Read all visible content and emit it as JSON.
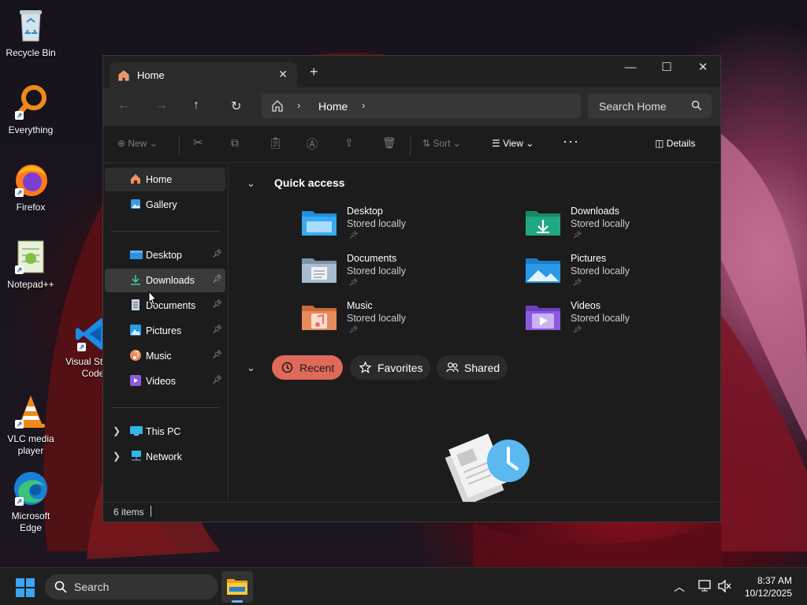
{
  "desktop": {
    "icons": [
      {
        "label": "Recycle Bin"
      },
      {
        "label": "Everything"
      },
      {
        "label": "Firefox"
      },
      {
        "label": "Notepad++"
      },
      {
        "label": "Visual Studio Code"
      },
      {
        "label": "VLC media player"
      },
      {
        "label": "Microsoft Edge"
      }
    ]
  },
  "window": {
    "tab_title": "Home",
    "path": "Home",
    "search_placeholder": "Search Home",
    "toolbar": {
      "new_label": "New",
      "sort_label": "Sort",
      "view_label": "View",
      "details_label": "Details"
    },
    "sidebar": {
      "top": [
        {
          "label": "Home"
        },
        {
          "label": "Gallery"
        }
      ],
      "pinned": [
        {
          "label": "Desktop"
        },
        {
          "label": "Downloads"
        },
        {
          "label": "Documents"
        },
        {
          "label": "Pictures"
        },
        {
          "label": "Music"
        },
        {
          "label": "Videos"
        }
      ],
      "bottom": [
        {
          "label": "This PC"
        },
        {
          "label": "Network"
        }
      ]
    },
    "quick_access": {
      "heading": "Quick access",
      "items": [
        {
          "name": "Desktop",
          "status": "Stored locally",
          "color": "#1e90e0"
        },
        {
          "name": "Downloads",
          "status": "Stored locally",
          "color": "#1fa882"
        },
        {
          "name": "Documents",
          "status": "Stored locally",
          "color": "#9fb3c8"
        },
        {
          "name": "Pictures",
          "status": "Stored locally",
          "color": "#2a9ae8"
        },
        {
          "name": "Music",
          "status": "Stored locally",
          "color": "#e88b5a"
        },
        {
          "name": "Videos",
          "status": "Stored locally",
          "color": "#8a5ae0"
        }
      ]
    },
    "filters": {
      "recent": "Recent",
      "favorites": "Favorites",
      "shared": "Shared"
    },
    "status_text": "6 items"
  },
  "taskbar": {
    "search_placeholder": "Search",
    "time": "8:37 AM",
    "date": "10/12/2025"
  },
  "colors": {
    "accent": "#e06a5a",
    "window_bg": "#1c1c1c"
  }
}
